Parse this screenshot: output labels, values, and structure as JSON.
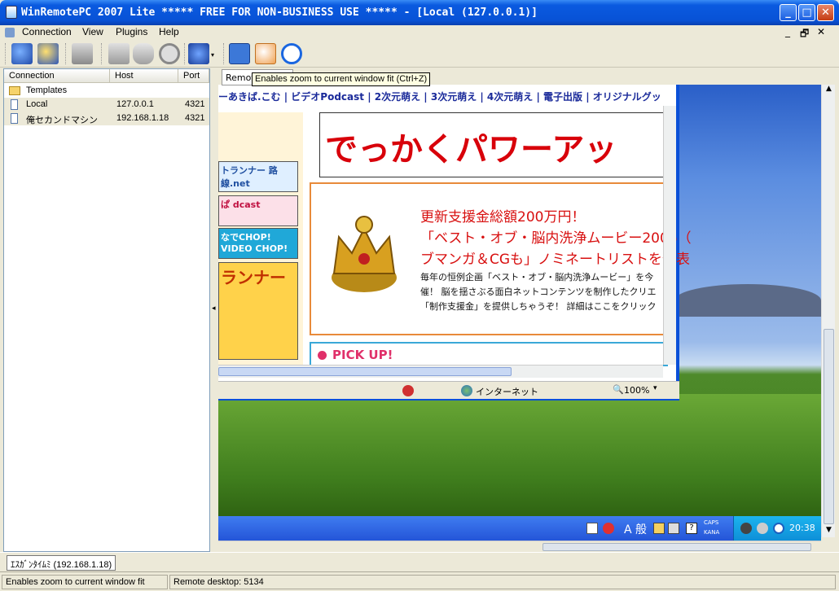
{
  "window": {
    "title": "WinRemotePC 2007 Lite   ***** FREE FOR NON-BUSINESS USE ***** - [Local (127.0.0.1)]",
    "minimize": "_",
    "maximize": "□",
    "close": "✕"
  },
  "menu": {
    "items": [
      "Connection",
      "View",
      "Plugins",
      "Help"
    ],
    "mdi_controls": [
      "_",
      "🗗",
      "✕"
    ]
  },
  "toolbar": {
    "buttons": [
      "connect-icon",
      "disconnect-icon",
      "computer-icon",
      "screen-icon",
      "keyboard-icon",
      "stop-icon",
      "dice-icon",
      "fit-zoom-icon",
      "mouse-icon",
      "stop-blue-icon"
    ]
  },
  "tooltip": "Enables zoom to current window fit (Ctrl+Z)",
  "remote_tab": "Remot",
  "connections": {
    "columns": [
      "Connection",
      "Host",
      "Port"
    ],
    "rows": [
      {
        "name": "Templates",
        "host": "",
        "port": "",
        "icon": "folder-icon"
      },
      {
        "name": "Local",
        "host": "127.0.0.1",
        "port": "4321",
        "icon": "computer-icon"
      },
      {
        "name": "俺セカンドマシン",
        "host": "192.168.1.18",
        "port": "4321",
        "icon": "computer-icon"
      }
    ]
  },
  "remote": {
    "ie_links": "ーあきば.こむ | ビデオPodcast | 2次元萌え | 3次元萌え | 4次元萌え | 電子出版 | オリジナルグッ",
    "banner": "でっかくパワーアッ",
    "news_title1": "更新支援金総額200万円！",
    "news_title2": "「ベスト・オブ・脳内洗浄ムービー2006（",
    "news_title3": "ブマンガ＆CGも」ノミネートリストを発表",
    "news_body1": "毎年の恒例企画「ベスト・オブ・脳内洗浄ムービー」を今",
    "news_body2": "催！ 脳を揺さぶる面白ネットコンテンツを制作したクリエ",
    "news_body3": "「制作支援金」を提供しちゃうぞ！ 詳細はここをクリック",
    "pickup": "PICK UP!",
    "ad1": "トランナー 路線.net",
    "ad2": "ぱ dcast",
    "ad3": "なでCHOP! VIDEO CHOP!",
    "ad4": "ランナー",
    "ie_zone": "インターネット",
    "ie_zoom": "100%",
    "tray_caps": "CAPS",
    "tray_kana": "KANA",
    "ime": "A 般",
    "clock": "20:38"
  },
  "document_tab": "ｴｽｶﾞﾝﾀｲﾑﾐ (192.168.1.18)",
  "status": {
    "left": "Enables zoom to current window fit",
    "right": "Remote desktop: 5134"
  }
}
